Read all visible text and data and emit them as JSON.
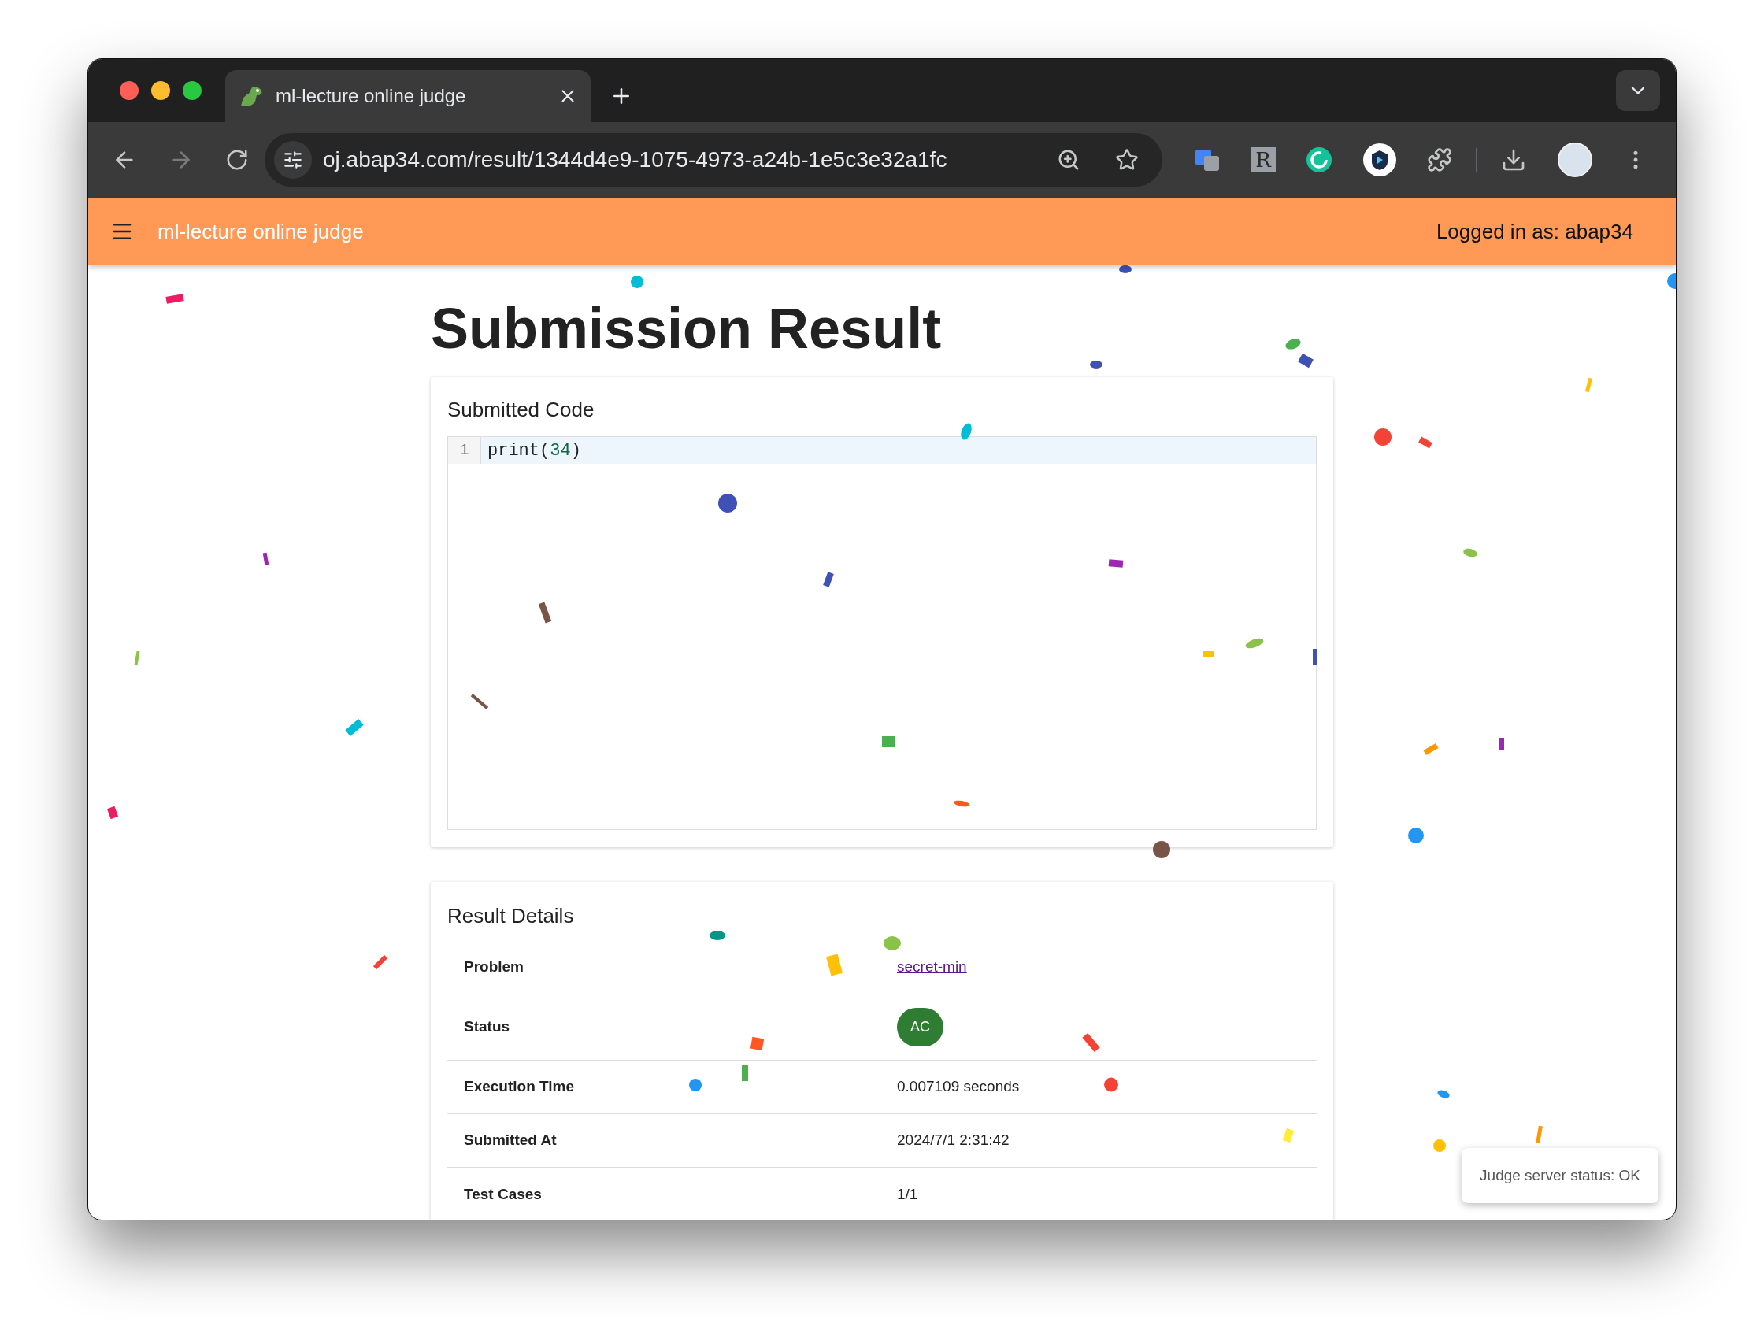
{
  "browser": {
    "tab": {
      "title": "ml-lecture online judge"
    },
    "url": "oj.abap34.com/result/1344d4e9-1075-4973-a24b-1e5c3e32a1fc",
    "extensions": [
      {
        "kind": "translate"
      },
      {
        "kind": "letter",
        "label": "R"
      },
      {
        "kind": "grammar"
      },
      {
        "kind": "shield"
      },
      {
        "kind": "puzzle"
      }
    ]
  },
  "app_bar": {
    "title": "ml-lecture online judge",
    "user": "Logged in as: abap34"
  },
  "page": {
    "title": "Submission Result"
  },
  "code_card": {
    "title": "Submitted Code",
    "lines": [
      {
        "number": "1",
        "tokens": [
          {
            "text": "print(",
            "kind": "plain"
          },
          {
            "text": "34",
            "kind": "number"
          },
          {
            "text": ")",
            "kind": "plain"
          }
        ]
      }
    ]
  },
  "result_card": {
    "title": "Result Details",
    "rows": [
      {
        "label": "Problem",
        "kind": "link",
        "value": "secret-min"
      },
      {
        "label": "Status",
        "kind": "badge",
        "value": "AC"
      },
      {
        "label": "Execution Time",
        "kind": "text",
        "value": "0.007109 seconds"
      },
      {
        "label": "Submitted At",
        "kind": "text",
        "value": "2024/7/1 2:31:42"
      },
      {
        "label": "Test Cases",
        "kind": "text",
        "value": "1/1"
      }
    ]
  },
  "toast": {
    "text": "Judge server status: OK"
  }
}
